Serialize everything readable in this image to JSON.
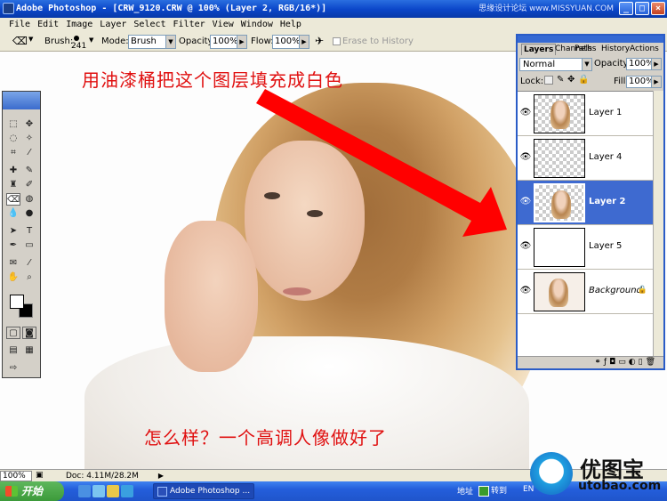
{
  "window": {
    "title": "Adobe Photoshop - [CRW_9120.CRW @ 100% (Layer 2, RGB/16*)]",
    "watermark_top": "思缘设计论坛 www.MISSYUAN.COM",
    "min_label": "_",
    "max_label": "□",
    "close_label": "×"
  },
  "menu": [
    "File",
    "Edit",
    "Image",
    "Layer",
    "Select",
    "Filter",
    "View",
    "Window",
    "Help"
  ],
  "options": {
    "brush_label": "Brush:",
    "brush_size": "241",
    "mode_label": "Mode:",
    "mode_value": "Brush",
    "opacity_label": "Opacity:",
    "opacity_value": "100%",
    "flow_label": "Flow:",
    "flow_value": "100%",
    "erase_history": "Erase to History"
  },
  "annotations": {
    "top": "用油漆桶把这个图层填充成白色",
    "bottom": "怎么样？一个高调人像做好了"
  },
  "layers_panel": {
    "tabs": [
      "Layers",
      "Channels",
      "Paths",
      "History",
      "Actions"
    ],
    "blend_mode": "Normal",
    "opacity_label": "Opacity:",
    "opacity_value": "100%",
    "lock_label": "Lock:",
    "fill_label": "Fill:",
    "fill_value": "100%",
    "layers": [
      {
        "name": "Layer 1",
        "selected": false
      },
      {
        "name": "Layer 4",
        "selected": false
      },
      {
        "name": "Layer 2",
        "selected": true
      },
      {
        "name": "Layer 5",
        "selected": false
      },
      {
        "name": "Background",
        "selected": false
      }
    ]
  },
  "status": {
    "zoom": "100%",
    "doc": "Doc: 4.11M/28.2M"
  },
  "taskbar": {
    "start": "开始",
    "task": "Adobe Photoshop ...",
    "address": "地址",
    "goto": "转到",
    "ime": "EN"
  },
  "logo": {
    "cn": "优图宝",
    "url": "utobao.com"
  }
}
